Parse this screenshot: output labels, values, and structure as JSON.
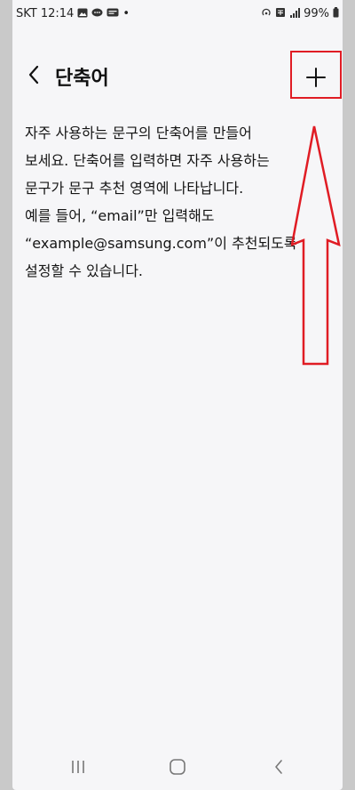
{
  "statusbar": {
    "carrier_time": "SKT 12:14",
    "dot": "•",
    "battery": "99%"
  },
  "header": {
    "back_icon": "chevron-left-icon",
    "title": "단축어",
    "add_label": "+"
  },
  "description": {
    "lines": [
      "자주 사용하는 문구의 단축어를 만들어",
      "보세요. 단축어를 입력하면 자주 사용하는",
      "문구가 문구 추천 영역에 나타납니다.",
      "예를 들어, “email”만 입력해도",
      "“example@samsung.com”이 추천되도록",
      "설정할 수 있습니다."
    ]
  },
  "annotation": {
    "color": "#e01c24"
  },
  "navbar": {
    "recents_icon": "recents-icon",
    "home_icon": "home-icon",
    "back_icon": "back-icon"
  }
}
